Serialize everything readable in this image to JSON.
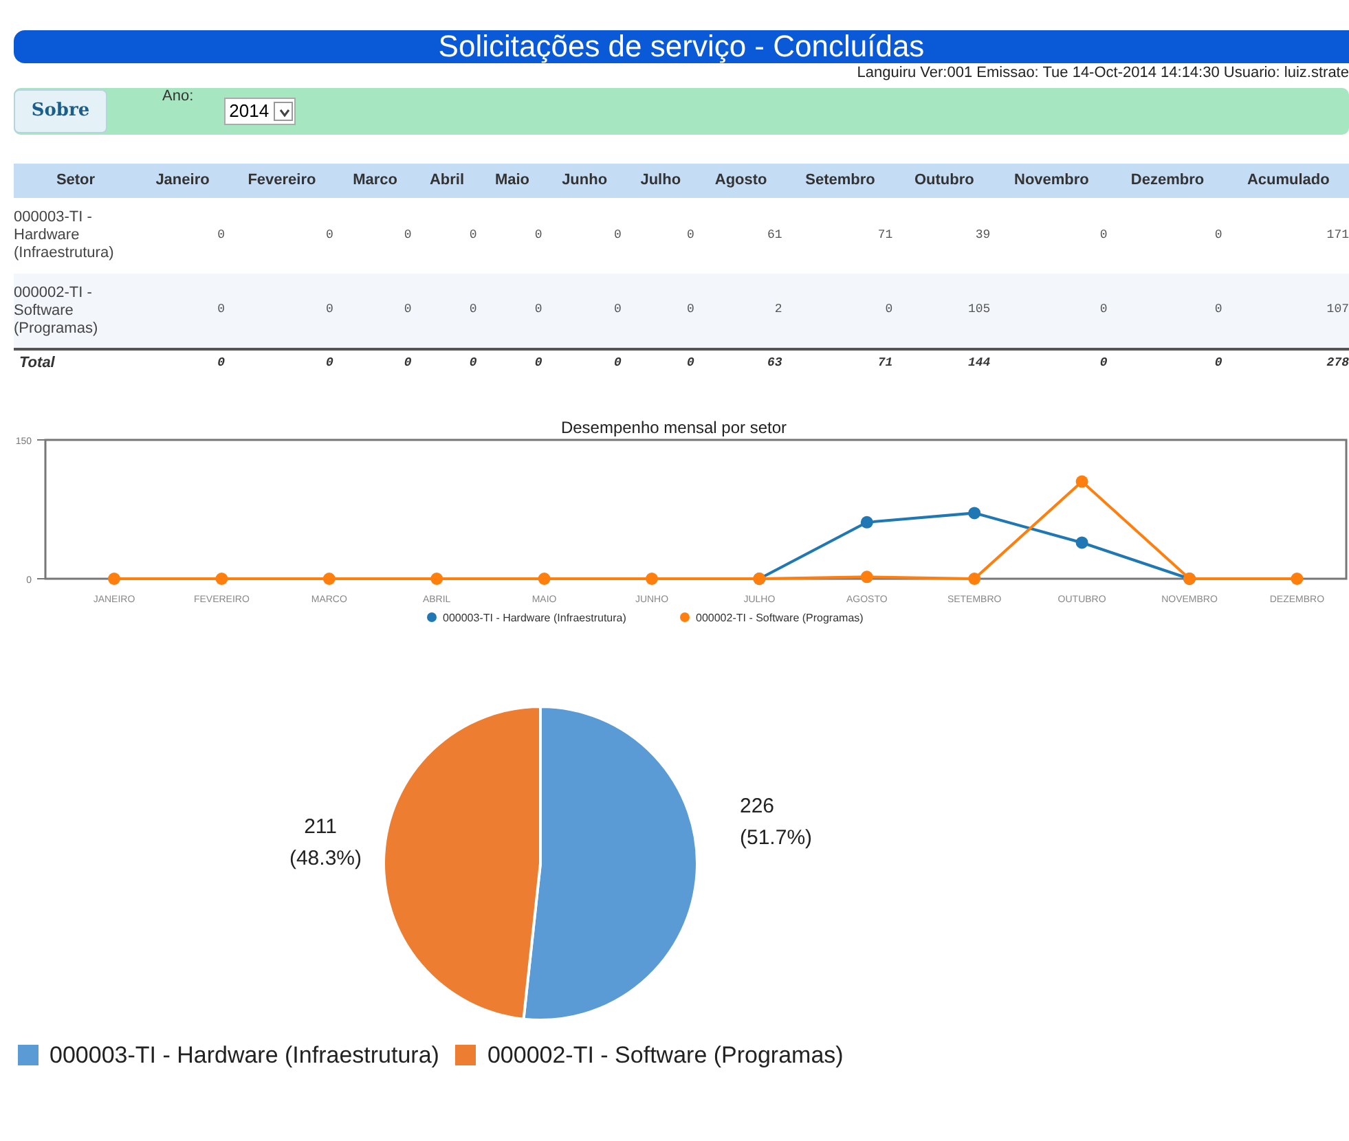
{
  "header": {
    "title": "Solicitações de serviço - Concluídas",
    "info": "Languiru Ver:001 Emissao: Tue 14-Oct-2014 14:14:30 Usuario: luiz.strate"
  },
  "toolbar": {
    "button": "Sobre",
    "year_label": "Ano:",
    "year_value": "2014"
  },
  "table": {
    "columns": [
      "Setor",
      "Janeiro",
      "Fevereiro",
      "Marco",
      "Abril",
      "Maio",
      "Junho",
      "Julho",
      "Agosto",
      "Setembro",
      "Outubro",
      "Novembro",
      "Dezembro",
      "Acumulado"
    ],
    "rows": [
      [
        "000003-TI - Hardware (Infraestrutura)",
        "0",
        "0",
        "0",
        "0",
        "0",
        "0",
        "0",
        "61",
        "71",
        "39",
        "0",
        "0",
        "171"
      ],
      [
        "000002-TI - Software (Programas)",
        "0",
        "0",
        "0",
        "0",
        "0",
        "0",
        "0",
        "2",
        "0",
        "105",
        "0",
        "0",
        "107"
      ]
    ],
    "total": [
      "Total",
      "0",
      "0",
      "0",
      "0",
      "0",
      "0",
      "0",
      "63",
      "71",
      "144",
      "0",
      "0",
      "278"
    ]
  },
  "line_chart": {
    "chart_data": {
      "type": "line",
      "legend": "bottom",
      "title": "Desempenho mensal por setor",
      "categories": [
        "JANEIRO",
        "FEVEREIRO",
        "MARCO",
        "ABRIL",
        "MAIO",
        "JUNHO",
        "JULHO",
        "AGOSTO",
        "SETEMBRO",
        "OUTUBRO",
        "NOVEMBRO",
        "DEZEMBRO"
      ],
      "ylim": [
        0,
        150
      ],
      "yticks": [
        0,
        150
      ],
      "series": [
        {
          "name": "000003-TI - Hardware (Infraestrutura)",
          "color": "#1f77b4",
          "marker": "circle",
          "values": [
            null,
            null,
            null,
            null,
            null,
            null,
            0,
            61,
            71,
            39,
            0,
            null
          ]
        },
        {
          "name": "000002-TI - Software (Programas)",
          "color": "#ff7f0e",
          "marker": "circle",
          "values": [
            0,
            0,
            0,
            0,
            0,
            0,
            0,
            2,
            0,
            105,
            0,
            0
          ]
        }
      ]
    }
  },
  "pie_chart": {
    "chart_data": {
      "type": "pie",
      "categories": [
        "000003-TI - Hardware (Infraestrutura)",
        "000002-TI - Software (Programas)"
      ],
      "values": [
        226,
        211
      ],
      "colors": [
        "#5b9bd5",
        "#ed7d31"
      ],
      "data_labels": true,
      "annotations": [
        {
          "text": "(51.7%)"
        },
        {
          "text": "(48.3%)"
        }
      ],
      "legend": "bottom"
    }
  }
}
